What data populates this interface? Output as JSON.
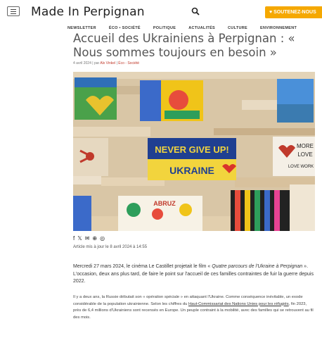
{
  "header": {
    "menu_icon": "hamburger-icon",
    "logo": "Made In Perpignan",
    "search_icon": "magnifier-icon",
    "cta_label": "♥ SOUTENEZ-NOUS",
    "accent_color": "#f5a800"
  },
  "nav": {
    "items": [
      {
        "label": "NEWSLETTER"
      },
      {
        "label": "ÉCO • SOCIÉTÉ"
      },
      {
        "label": "POLITIQUE"
      },
      {
        "label": "ACTUALITÉS"
      },
      {
        "label": "CULTURE"
      },
      {
        "label": "ENVIRONNEMENT"
      }
    ]
  },
  "article": {
    "title": "Accueil des Ukrainiens à Perpignan : « Nous sommes toujours en besoin »",
    "date": "4 avril 2024",
    "separator": "|",
    "by": "par",
    "author": "Alx Vinkel",
    "category": "Éco - Société",
    "image": {
      "blue_sign": "NEVER GIVE UP!",
      "yellow_sign": "UKRAINE",
      "right_sign_1": "MORE",
      "right_sign_2": "LOVE",
      "right_sign_3": "LOVE WORK",
      "abc_sign": "ABRUZ"
    },
    "share_icons": [
      "facebook-icon",
      "x-icon",
      "email-icon",
      "pinterest-icon",
      "whatsapp-icon"
    ],
    "updated": "Article mis à jour le 8 avril 2024 à 14:55",
    "p1_a": "Mercredi 27 mars 2024, le cinéma Le Castillet projetait le film « ",
    "p1_em": "Quatre parcours de l'Ukraine à Perpignan",
    "p1_b": " ». L'occasion, deux ans plus tard, de faire le point sur l'accueil de ces familles contraintes de fuir la guerre depuis 2022.",
    "p2_a": "Il y a deux ans, la Russie débutait son « opération spéciale » en attaquant l'Ukraine. Comme conséquence inévitable, un exode considérable de la population ukrainienne. Selon les chiffres du ",
    "p2_link": "Haut-Commissariat des Nations Unies pour les réfugiés",
    "p2_b": ", fin 2023, près de 6,4 millions d'Ukrainiens sont recensés en Europe. Un peuple contraint à la mobilité, avec des familles qui se retrouvent au fil des mois."
  }
}
